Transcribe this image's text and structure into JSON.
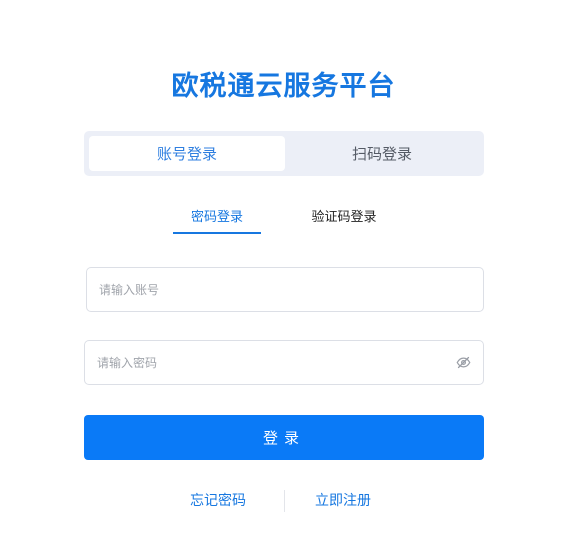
{
  "title": "欧税通云服务平台",
  "mode_tabs": [
    {
      "label": "账号登录",
      "active": true
    },
    {
      "label": "扫码登录",
      "active": false
    }
  ],
  "sub_tabs": [
    {
      "label": "密码登录",
      "active": true
    },
    {
      "label": "验证码登录",
      "active": false
    }
  ],
  "account_field": {
    "placeholder": "请输入账号",
    "value": ""
  },
  "password_field": {
    "placeholder": "请输入密码",
    "value": ""
  },
  "icons": {
    "password_toggle": "eye-off-icon"
  },
  "login_button": {
    "label": "登录"
  },
  "links": {
    "forgot": "忘记密码",
    "register": "立即注册"
  },
  "colors": {
    "accent": "#1677e0",
    "button": "#0a7af7",
    "switch_bg": "#eceff7"
  }
}
